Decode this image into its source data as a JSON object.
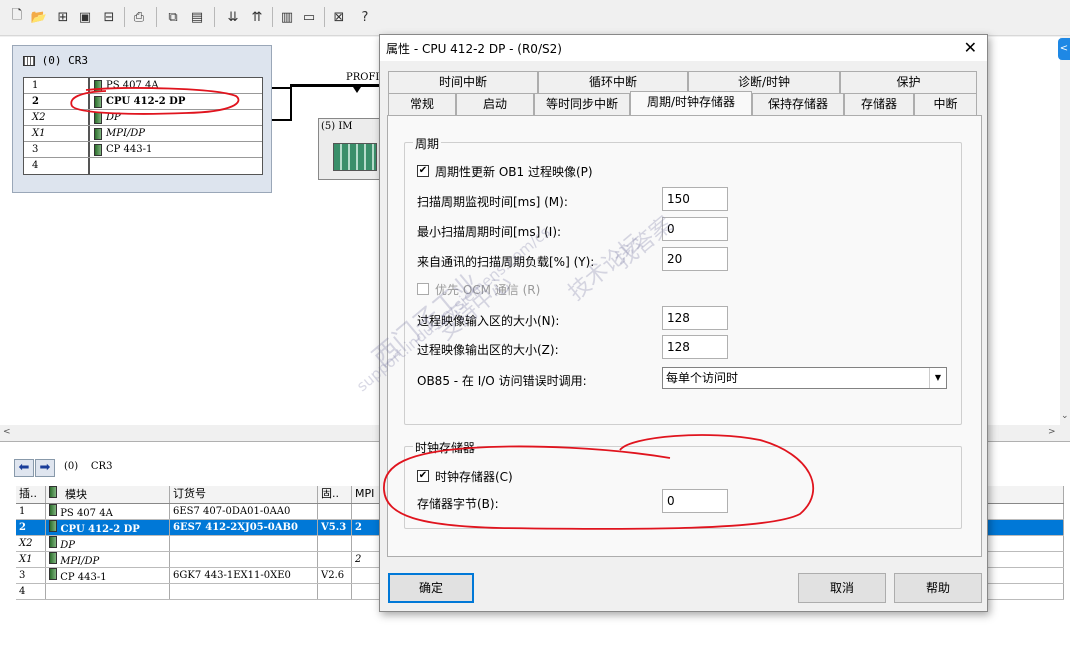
{
  "station": {
    "rack_title": "(0) CR3",
    "rack_rows": [
      {
        "slot": "1",
        "module": "PS 407 4A"
      },
      {
        "slot": "2",
        "module": "CPU 412-2 DP"
      },
      {
        "slot": "X2",
        "module": "DP"
      },
      {
        "slot": "X1",
        "module": "MPI/DP"
      },
      {
        "slot": "3",
        "module": "CP 443-1"
      },
      {
        "slot": "4",
        "module": ""
      }
    ],
    "network_label": "PROFI",
    "im_label": "(5) IM"
  },
  "bottom": {
    "path_num": "(0)",
    "path_name": "CR3",
    "headers": [
      "插..",
      "模块",
      "订货号",
      "固..",
      "MPI"
    ],
    "rows": [
      {
        "slot": "1",
        "module": "PS 407 4A",
        "order": "6ES7 407-0DA01-0AA0",
        "fw": "",
        "mpi": ""
      },
      {
        "slot": "2",
        "module": "CPU 412-2 DP",
        "order": "6ES7 412-2XJ05-0AB0",
        "fw": "V5.3",
        "mpi": "2"
      },
      {
        "slot": "X2",
        "module": "DP",
        "order": "",
        "fw": "",
        "mpi": ""
      },
      {
        "slot": "X1",
        "module": "MPI/DP",
        "order": "",
        "fw": "",
        "mpi": "2"
      },
      {
        "slot": "3",
        "module": "CP 443-1",
        "order": "6GK7 443-1EX11-0XE0",
        "fw": "V2.6",
        "mpi": ""
      },
      {
        "slot": "4",
        "module": "",
        "order": "",
        "fw": "",
        "mpi": ""
      }
    ]
  },
  "dialog": {
    "title": "属性 - CPU 412-2 DP - (R0/S2)",
    "tabs_row1": [
      "时间中断",
      "循环中断",
      "诊断/时钟",
      "保护"
    ],
    "tabs_row2": [
      "常规",
      "启动",
      "等时同步中断",
      "周期/时钟存储器",
      "保持存储器",
      "存储器",
      "中断"
    ],
    "cycle_group": "周期",
    "cb_update_ob1": "周期性更新 OB1 过程映像(P)",
    "scan_monitor_label": "扫描周期监视时间[ms] (M):",
    "scan_monitor_value": "150",
    "min_scan_label": "最小扫描周期时间[ms] (I):",
    "min_scan_value": "0",
    "comm_load_label": "来自通讯的扫描周期负载[%] (Y):",
    "comm_load_value": "20",
    "ocm_label": "优先 OCM 通信 (R)",
    "pii_label": "过程映像输入区的大小(N):",
    "pii_value": "128",
    "piq_label": "过程映像输出区的大小(Z):",
    "piq_value": "128",
    "ob85_label": "OB85 - 在 I/O 访问错误时调用:",
    "ob85_value": "每单个访问时",
    "clock_group": "时钟存储器",
    "cb_clock": "时钟存储器(C)",
    "clock_byte_label": "存储器字节(B):",
    "clock_byte_value": "0",
    "ok": "确定",
    "cancel": "取消",
    "help": "帮助"
  },
  "watermark": [
    "西门子工业",
    "支持中心",
    "support.industry.siemens.com/cs",
    "技术论坛",
    "找答案"
  ],
  "colors": {
    "selection": "#0078d7",
    "annotation": "#e0141e"
  }
}
